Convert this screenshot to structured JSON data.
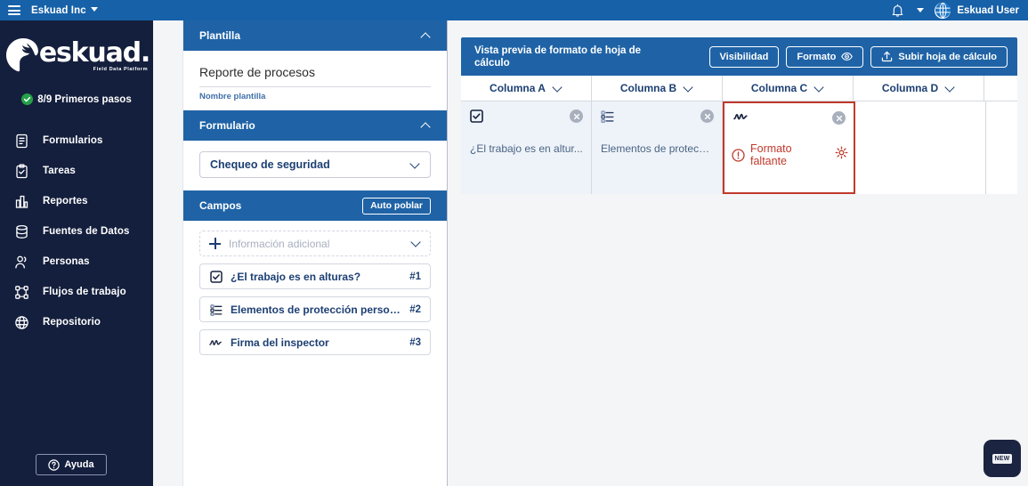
{
  "topbar": {
    "menu_icon": "hamburger-icon",
    "org_name": "Eskuad Inc",
    "bell_icon": "bell-icon",
    "chevron_icon": "chevron-down-icon",
    "avatar_icon": "globe-avatar-icon",
    "user_name": "Eskuad User"
  },
  "sidebar": {
    "logo_word": "eskuad",
    "logo_dot": ".",
    "logo_tagline": "Field Data Platform",
    "onboarding": {
      "label": "8/9 Primeros pasos",
      "check_icon": "check-circle-icon",
      "accent": "#24a148"
    },
    "items": [
      {
        "label": "Formularios",
        "icon": "form-document-icon"
      },
      {
        "label": "Tareas",
        "icon": "clipboard-check-icon"
      },
      {
        "label": "Reportes",
        "icon": "bar-chart-icon"
      },
      {
        "label": "Fuentes de Datos",
        "icon": "database-icon"
      },
      {
        "label": "Personas",
        "icon": "people-icon"
      },
      {
        "label": "Flujos de trabajo",
        "icon": "workflow-icon"
      },
      {
        "label": "Repositorio",
        "icon": "globe-icon"
      }
    ],
    "help": {
      "label": "Ayuda",
      "icon": "question-circle-icon"
    }
  },
  "config_panel": {
    "template_section": {
      "title": "Plantilla",
      "collapse_icon": "chevron-up-icon",
      "value": "Reporte de procesos",
      "caption": "Nombre plantilla"
    },
    "form_section": {
      "title": "Formulario",
      "collapse_icon": "chevron-up-icon",
      "selected": "Chequeo de seguridad",
      "dropdown_icon": "chevron-down-icon"
    },
    "fields_section": {
      "title": "Campos",
      "auto_button": "Auto poblar",
      "add_row": {
        "placeholder": "Información adicional",
        "plus_icon": "plus-icon",
        "dropdown_icon": "chevron-down-icon"
      },
      "fields": [
        {
          "label": "¿El trabajo es en alturas?",
          "num": "#1",
          "icon": "checkbox-icon"
        },
        {
          "label": "Elementos de protección person...",
          "num": "#2",
          "icon": "checklist-icon"
        },
        {
          "label": "Firma del inspector",
          "num": "#3",
          "icon": "signature-icon"
        }
      ]
    }
  },
  "preview": {
    "title": "Vista previa de formato de hoja de cálculo",
    "buttons": [
      {
        "label": "Visibilidad",
        "icon": ""
      },
      {
        "label": "Formato",
        "icon": "eye-icon"
      },
      {
        "label": "Subir hoja de cálculo",
        "icon": "upload-icon"
      }
    ],
    "columns": [
      {
        "label": "Columna A",
        "icon": "chevron-down-icon"
      },
      {
        "label": "Columna B",
        "icon": "chevron-down-icon"
      },
      {
        "label": "Columna C",
        "icon": "chevron-down-icon"
      },
      {
        "label": "Columna D",
        "icon": "chevron-down-icon"
      }
    ],
    "cells": [
      {
        "text": "¿El trabajo es en altur...",
        "icon": "checkbox-icon",
        "remove_icon": "close-circle-icon",
        "error": false
      },
      {
        "text": "Elementos de protecci...",
        "icon": "checklist-icon",
        "remove_icon": "close-circle-icon",
        "error": false
      },
      {
        "text": "Formato faltante",
        "icon": "signature-icon",
        "remove_icon": "close-circle-icon",
        "error": true,
        "error_icon": "alert-circle-icon",
        "settings_icon": "gear-icon",
        "error_color": "#c0392b"
      }
    ]
  },
  "fab": {
    "badge": "NEW",
    "icon": "new-widget-icon"
  }
}
